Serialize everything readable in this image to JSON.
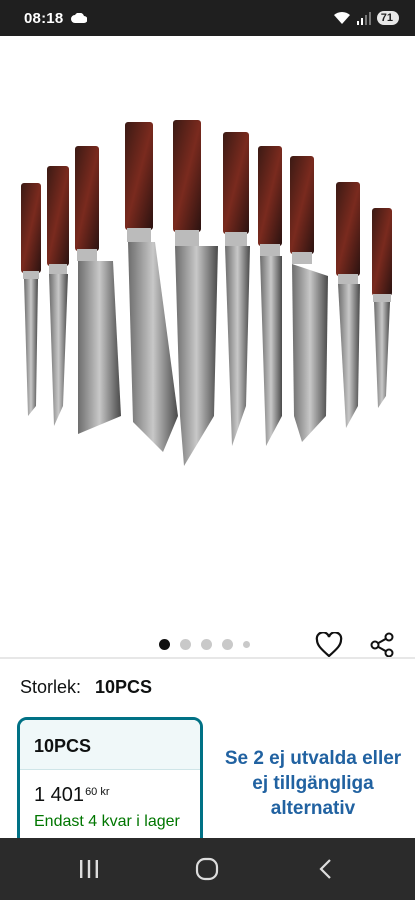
{
  "status_bar": {
    "time": "08:18",
    "battery": "71",
    "icons": [
      "cloud-icon",
      "wifi-icon",
      "signal-icon",
      "battery-icon"
    ]
  },
  "gallery": {
    "image_description": "knife-set-product-image",
    "dots_count": 5,
    "active_dot": 0,
    "icons": [
      "heart-icon",
      "share-icon"
    ]
  },
  "size": {
    "label": "Storlek:",
    "value": "10PCS"
  },
  "option_card": {
    "title": "10PCS",
    "price_main": "1 401",
    "price_fraction": "60",
    "currency": "kr",
    "stock": "Endast 4 kvar i lager"
  },
  "alternatives": {
    "text": "Se 2 ej utvalda eller ej tillgängliga alternativ"
  },
  "nav_bar": {
    "icons": [
      "recents-icon",
      "home-icon",
      "back-icon"
    ]
  },
  "colors": {
    "link": "#2162a1",
    "accent_border": "#007185",
    "stock_green": "#007600"
  }
}
